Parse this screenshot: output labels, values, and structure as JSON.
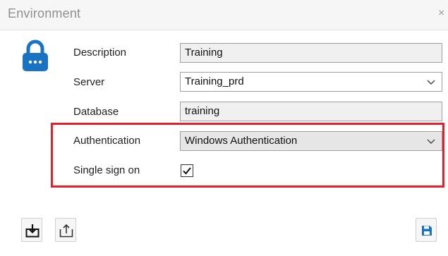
{
  "window": {
    "title": "Environment",
    "close_glyph": "×"
  },
  "form": {
    "description": {
      "label": "Description",
      "value": "Training"
    },
    "server": {
      "label": "Server",
      "value": "Training_prd"
    },
    "database": {
      "label": "Database",
      "value": "training"
    },
    "authentication": {
      "label": "Authentication",
      "value": "Windows Authentication"
    },
    "single_sign_on": {
      "label": "Single sign on",
      "checked": true
    }
  },
  "icons": {
    "lock": "lock-icon",
    "chevron": "chevron-down-icon",
    "import": "import-icon",
    "export": "export-icon",
    "save": "save-icon",
    "check": "checkmark-icon"
  },
  "colors": {
    "accent": "#1a73c2",
    "highlight": "#e3212d"
  }
}
